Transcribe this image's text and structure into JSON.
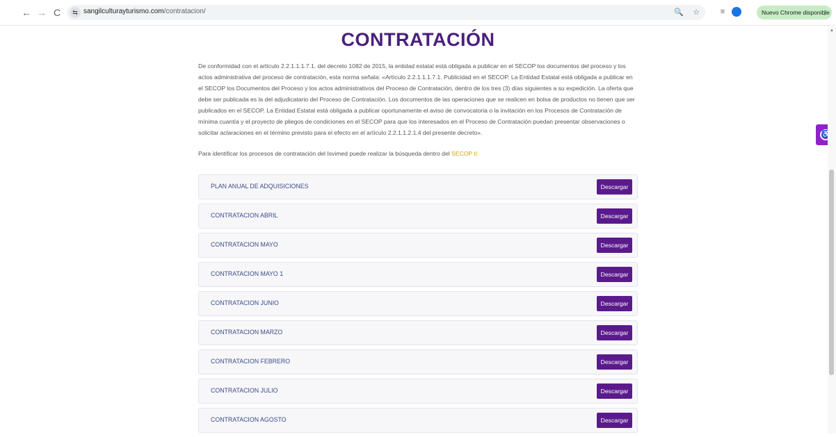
{
  "browser": {
    "back_icon": "←",
    "forward_icon": "→",
    "reload_icon": "C",
    "site_info_icon": "⇆",
    "url_domain": "sangilculturayturismo.com",
    "url_path": "/contratacion/",
    "zoom_icon": "🔍",
    "bookmark_icon": "☆",
    "extension_icon": "≡",
    "update_label": "Nuevo Chrome disponible",
    "menu_icon": "⋮"
  },
  "page": {
    "title": "CONTRATACIÓN",
    "intro": "De conformidad con el artículo 2.2.1.1.1.7.1. del decreto 1082 de 2015, la entidad estatal está obligada a publicar en el SECOP los documentos del proceso y los actos administrativa del proceso de contratación, esta norma señala: «Artículo 2.2.1.1.1.7.1. Publicidad en el SECOP. La Entidad Estatal está obligada a publicar en el SECOP los Documentos del Proceso y los actos administrativos del Proceso de Contratación, dentro de los tres (3) días siguientes a su expedición. La oferta que debe ser publicada es la del adjudicatario del Proceso de Contratación. Los documentos de las operaciones que se realicen en bolsa de productos no tienen que ser publicados en el SECOP. La Entidad Estatal está obligada a publicar oportunamente el aviso de convocatoria o la invitación en los Procesos de Contratación de mínima cuantía y el proyecto de pliegos de condiciones en el SECOP para que los interesados en el Proceso de Contratación puedan presentar observaciones o solicitar aclaraciones en el término previsto para el efecto en el artículo 2.2.1.1.2.1.4 del presente decreto».",
    "search_note": "Para identificar los procesos de contratación del Isvimed puede realizar la búsqueda dentro del ",
    "search_link": "SECOP II",
    "download_label": "Descargar",
    "items": [
      {
        "label": "PLAN ANUAL DE ADQUISICIONES"
      },
      {
        "label": "CONTRATACION ABRIL"
      },
      {
        "label": "CONTRATACION MAYO"
      },
      {
        "label": "CONTRATACION MAYO 1"
      },
      {
        "label": "CONTRATACION JUNIO"
      },
      {
        "label": "CONTRATACION MARZO"
      },
      {
        "label": "CONTRATACION FEBRERO"
      },
      {
        "label": "CONTRATACION JULIO"
      },
      {
        "label": "CONTRATACION AGOSTO"
      }
    ]
  },
  "colors": {
    "title": "#4a1f7c",
    "button": "#5b1a8c",
    "link": "#d4a017",
    "a11y_widget": "#8e24c7"
  }
}
